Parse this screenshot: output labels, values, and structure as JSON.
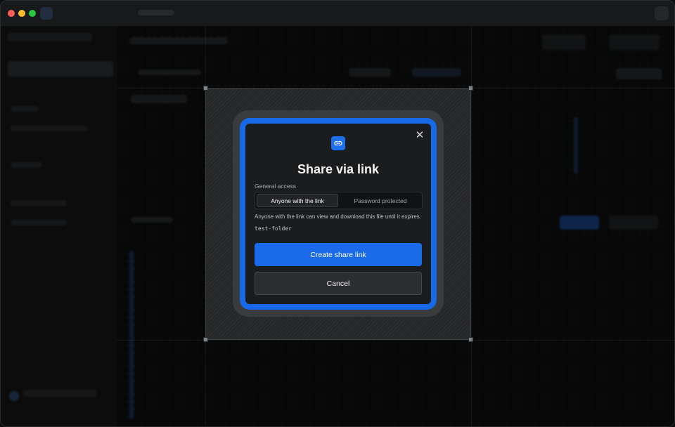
{
  "dialog": {
    "title": "Share via link",
    "close_icon": "close-icon",
    "header_icon": "link-icon",
    "access_label": "General access",
    "access_options": [
      {
        "label": "Anyone with the link",
        "selected": true
      },
      {
        "label": "Password protected",
        "selected": false
      }
    ],
    "access_hint": "Anyone with the link can view and download this file until it expires.",
    "item_name": "test-folder",
    "create_button_label": "Create share link",
    "cancel_button_label": "Cancel"
  },
  "colors": {
    "accent": "#1b6ae9",
    "dialog_background": "#1b1c1e",
    "frame_ring": "#1769e8"
  }
}
